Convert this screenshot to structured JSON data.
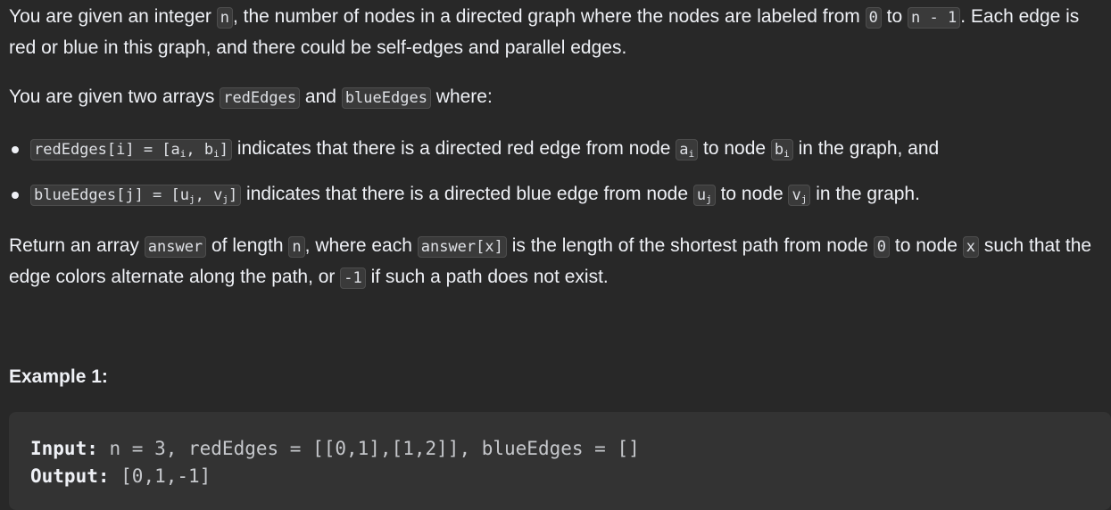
{
  "paragraph1": {
    "t1": "You are given an integer ",
    "c1": "n",
    "t2": ", the number of nodes in a directed graph where the nodes are labeled from ",
    "c2": "0",
    "t3": " to ",
    "c3": "n - 1",
    "t4": ". Each edge is red or blue in this graph, and there could be self-edges and parallel edges."
  },
  "paragraph2": {
    "t1": "You are given two arrays ",
    "c1": "redEdges",
    "t2": " and ",
    "c2": "blueEdges",
    "t3": " where:"
  },
  "bullets": [
    {
      "code_pre": "redEdges[i] = [a",
      "sub1": "i",
      "code_mid": ", b",
      "sub2": "i",
      "code_post": "]",
      "t1": " indicates that there is a directed red edge from node ",
      "node1": "a",
      "node1_sub": "i",
      "t2": " to node ",
      "node2": "b",
      "node2_sub": "i",
      "t3": " in the graph, and"
    },
    {
      "code_pre": "blueEdges[j] = [u",
      "sub1": "j",
      "code_mid": ", v",
      "sub2": "j",
      "code_post": "]",
      "t1": " indicates that there is a directed blue edge from node ",
      "node1": "u",
      "node1_sub": "j",
      "t2": " to node ",
      "node2": "v",
      "node2_sub": "j",
      "t3": " in the graph."
    }
  ],
  "paragraph3": {
    "t1": "Return an array ",
    "c1": "answer",
    "t2": " of length ",
    "c2": "n",
    "t3": ", where each ",
    "c3": "answer[x]",
    "t4": " is the length of the shortest path from node ",
    "c4": "0",
    "t5": " to node ",
    "c5": "x",
    "t6": " such that the edge colors alternate along the path, or ",
    "c6": "-1",
    "t7": " if such a path does not exist."
  },
  "example": {
    "title": "Example 1:",
    "input_label": "Input:",
    "input_value": " n = 3, redEdges = [[0,1],[1,2]], blueEdges = []",
    "output_label": "Output:",
    "output_value": " [0,1,-1]"
  }
}
